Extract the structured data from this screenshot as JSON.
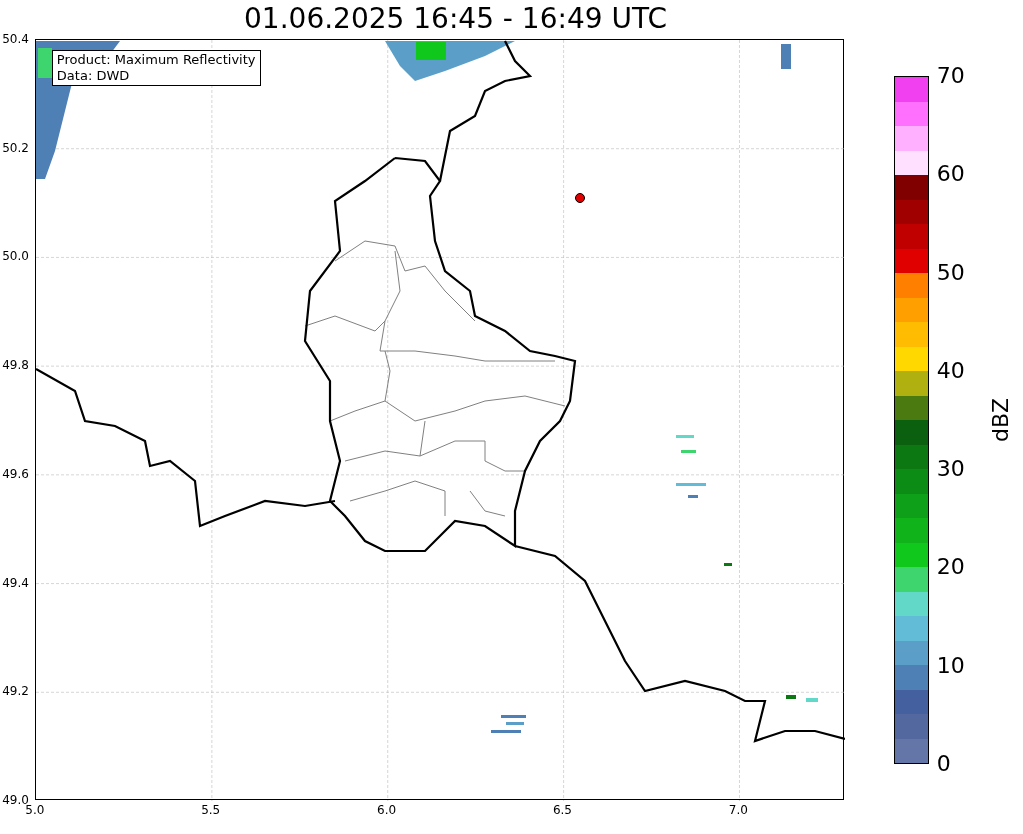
{
  "title": "01.06.2025 16:45 - 16:49 UTC",
  "map": {
    "legend": [
      "Product: Maximum Reflectivity",
      "Data: DWD"
    ],
    "x_ticks": [
      "5.0",
      "5.5",
      "6.0",
      "6.5",
      "7.0"
    ],
    "y_ticks": [
      "50.4",
      "50.2",
      "50.0",
      "49.8",
      "49.6",
      "49.4",
      "49.2",
      "49.0"
    ]
  },
  "colorbar": {
    "label": "dBZ",
    "ticks": [
      "70",
      "60",
      "50",
      "40",
      "30",
      "20",
      "10",
      "0"
    ],
    "segments": [
      {
        "color": "#f040f0"
      },
      {
        "color": "#ff70ff"
      },
      {
        "color": "#ffb0ff"
      },
      {
        "color": "#ffe0ff"
      },
      {
        "color": "#800000"
      },
      {
        "color": "#a00000"
      },
      {
        "color": "#c00000"
      },
      {
        "color": "#e00000"
      },
      {
        "color": "#ff8000"
      },
      {
        "color": "#ffa000"
      },
      {
        "color": "#ffbc00"
      },
      {
        "color": "#ffd800"
      },
      {
        "color": "#b0b010"
      },
      {
        "color": "#4a7a10"
      },
      {
        "color": "#0a600e"
      },
      {
        "color": "#0c7812"
      },
      {
        "color": "#0c8c14"
      },
      {
        "color": "#0ea018"
      },
      {
        "color": "#10b41a"
      },
      {
        "color": "#10c81c"
      },
      {
        "color": "#3ed46e"
      },
      {
        "color": "#62d8c8"
      },
      {
        "color": "#62bcd8"
      },
      {
        "color": "#5b9ec8"
      },
      {
        "color": "#4e7fb5"
      },
      {
        "color": "#44609f"
      },
      {
        "color": "#5468a0"
      },
      {
        "color": "#6476a8"
      }
    ]
  }
}
